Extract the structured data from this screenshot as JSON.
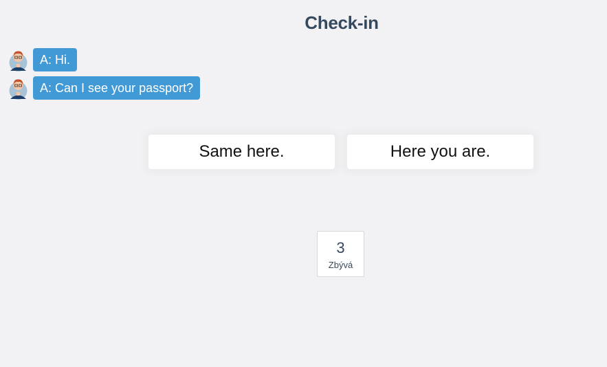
{
  "header": {
    "title": "Check-in"
  },
  "chat": {
    "messages": [
      {
        "text": "A: Hi."
      },
      {
        "text": "A: Can I see your passport?"
      }
    ]
  },
  "options": [
    {
      "label": "Same here."
    },
    {
      "label": "Here you are."
    }
  ],
  "counter": {
    "value": "3",
    "label": "Zbývá"
  },
  "colors": {
    "background": "#f2f2f5",
    "bubble": "#4199d6",
    "title": "#34495e"
  },
  "icons": {
    "avatar": "person-avatar-icon"
  }
}
